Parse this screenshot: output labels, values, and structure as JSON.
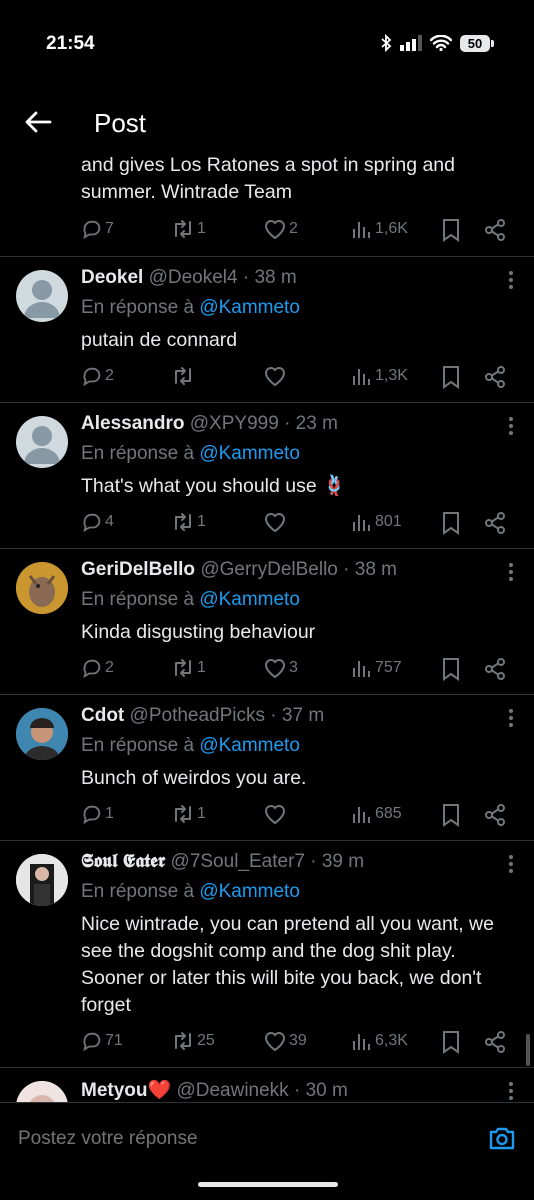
{
  "status_bar": {
    "time": "21:54",
    "battery": "50"
  },
  "header": {
    "title": "Post"
  },
  "partial_tweet": {
    "text": "and gives Los Ratones a spot in spring and summer. Wintrade Team",
    "replies": "7",
    "reposts": "1",
    "likes": "2",
    "views": "1,6K"
  },
  "tweets": [
    {
      "name": "Deokel",
      "handle": "@Deokel4",
      "time": "38 m",
      "reply_prefix": "En réponse à",
      "reply_to": "@Kammeto",
      "text": "putain de connard",
      "replies": "2",
      "reposts": "",
      "likes": "",
      "views": "1,3K"
    },
    {
      "name": "Alessandro",
      "handle": "@XPY999",
      "time": "23 m",
      "reply_prefix": "En réponse à",
      "reply_to": "@Kammeto",
      "text": "That's what you should use 🪢",
      "replies": "4",
      "reposts": "1",
      "likes": "",
      "views": "801"
    },
    {
      "name": "GeriDelBello",
      "handle": "@GerryDelBello",
      "time": "38 m",
      "reply_prefix": "En réponse à",
      "reply_to": "@Kammeto",
      "text": "Kinda disgusting behaviour",
      "replies": "2",
      "reposts": "1",
      "likes": "3",
      "views": "757"
    },
    {
      "name": "Cdot",
      "handle": "@PotheadPicks",
      "time": "37 m",
      "reply_prefix": "En réponse à",
      "reply_to": "@Kammeto",
      "text": "Bunch of weirdos you are.",
      "replies": "1",
      "reposts": "1",
      "likes": "",
      "views": "685"
    },
    {
      "name": "𝕾𝖔𝖚𝖑 𝕰𝖆𝖙𝖊𝖗",
      "handle": "@7Soul_Eater7",
      "time": "39 m",
      "reply_prefix": "En réponse à",
      "reply_to": "@Kammeto",
      "text": "Nice wintrade, you can pretend all you want, we see the dogshit comp and the dog shit play. Sooner or later this will bite you back, we don't forget",
      "replies": "71",
      "reposts": "25",
      "likes": "39",
      "views": "6,3K"
    },
    {
      "name": "Metyou❤️",
      "handle": "@Deawinekk",
      "time": "30 m"
    }
  ],
  "composer": {
    "placeholder": "Postez votre réponse"
  },
  "colors": {
    "background": "#000000",
    "text": "#e7e9ea",
    "muted": "#71767b",
    "accent": "#1d9bf0",
    "divider": "#2f3336"
  }
}
